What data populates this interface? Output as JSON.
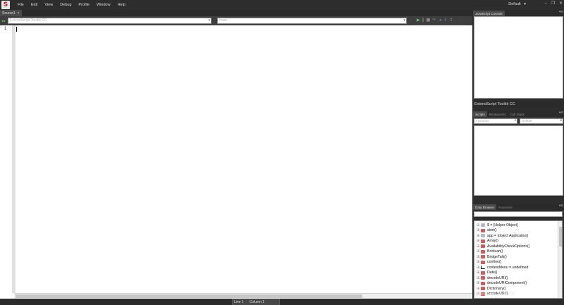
{
  "menubar": {
    "logo": "S",
    "items": [
      "File",
      "Edit",
      "View",
      "Debug",
      "Profile",
      "Window",
      "Help"
    ],
    "workspace": "Default",
    "workspace_arrow": "▾",
    "controls": [
      "–",
      "❐",
      "✕"
    ]
  },
  "editor": {
    "tab_label": "Source1",
    "tab_close": "×",
    "target_app": "ExtendScript Toolkit CC",
    "engine": "main",
    "line_number": "1",
    "debug_icons": [
      "▶",
      "‖",
      "■",
      "↷",
      "⇥",
      "⇩",
      "↥"
    ]
  },
  "status": {
    "line": "Line 1",
    "column": "Column 1"
  },
  "console": {
    "tab": "JavaScript Console",
    "footer": "ExtendScript Toolkit CC"
  },
  "scripts": {
    "tabs": [
      "Scripts",
      "Breakpoints",
      "Call Stack"
    ],
    "favorites": "Favorites",
    "default": "Default"
  },
  "data_browser": {
    "tabs": [
      "Data Browser",
      "Functions"
    ],
    "items": [
      {
        "label": "$ = [Helper Object]",
        "icon": "#b9b9c9"
      },
      {
        "label": "alert()",
        "icon": "#d45a5a"
      },
      {
        "label": "app = [object Application]",
        "icon": "#b9b9c9"
      },
      {
        "label": "Array()",
        "icon": "#d45a5a"
      },
      {
        "label": "AvailabilityCheckOptions()",
        "icon": "#d45a5a"
      },
      {
        "label": "Boolean()",
        "icon": "#d45a5a"
      },
      {
        "label": "BridgeTalk()",
        "icon": "#d45a5a"
      },
      {
        "label": "confirm()",
        "icon": "#d45a5a"
      },
      {
        "label": "contextMenu = undefined",
        "icon": "#000000"
      },
      {
        "label": "Date()",
        "icon": "#d45a5a"
      },
      {
        "label": "decodeURI()",
        "icon": "#d45a5a"
      },
      {
        "label": "decodeURIComponent()",
        "icon": "#d45a5a"
      },
      {
        "label": "Dictionary()",
        "icon": "#d45a5a"
      },
      {
        "label": "encodeURI()",
        "icon": "#d45a5a"
      }
    ],
    "footer": "ExtendScript Toolkit CC"
  }
}
